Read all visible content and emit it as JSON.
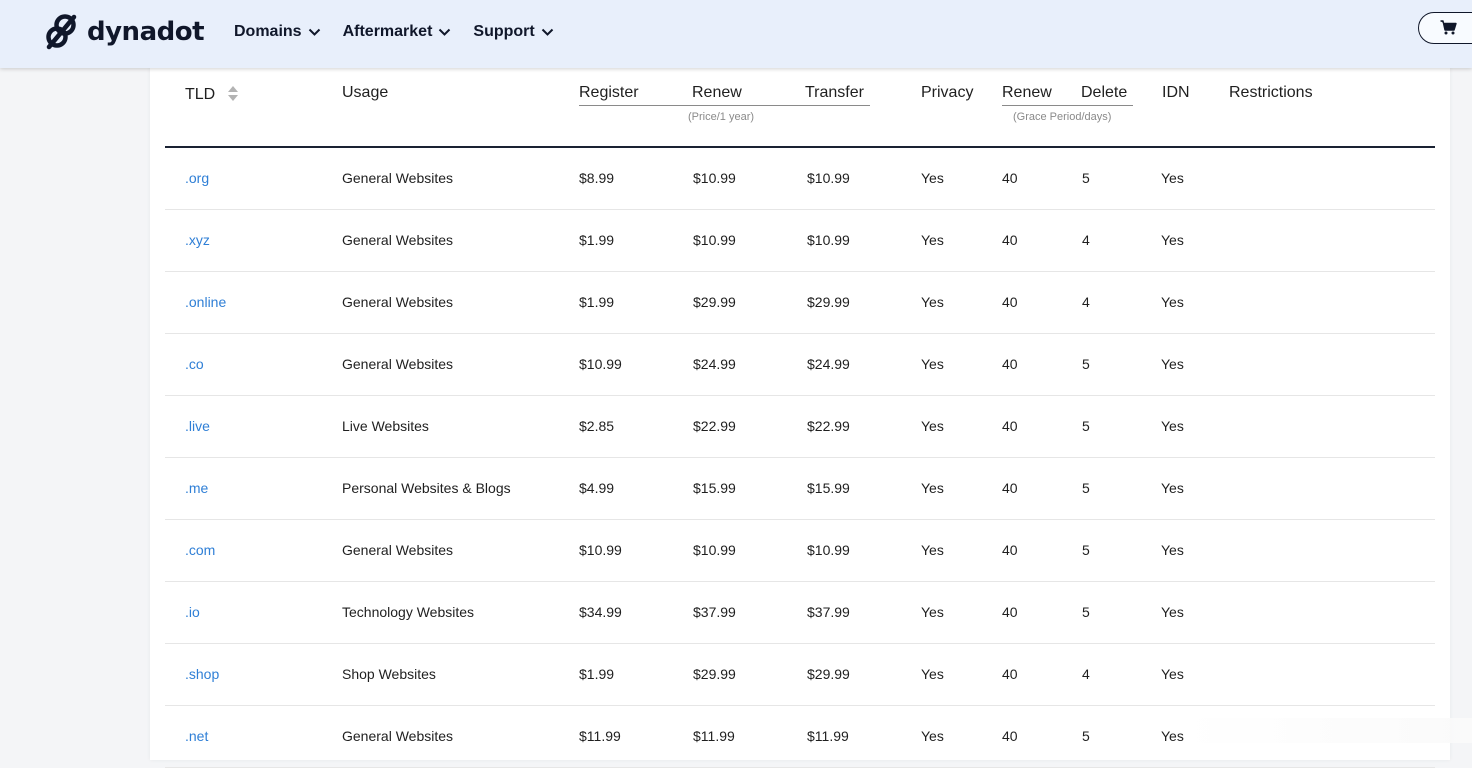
{
  "header": {
    "brand": "dynadot",
    "nav": [
      {
        "label": "Domains"
      },
      {
        "label": "Aftermarket"
      },
      {
        "label": "Support"
      }
    ]
  },
  "table": {
    "headers": {
      "tld": "TLD",
      "usage": "Usage",
      "register": "Register",
      "renew": "Renew",
      "transfer": "Transfer",
      "privacy": "Privacy",
      "grace_renew": "Renew",
      "grace_delete": "Delete",
      "idn": "IDN",
      "restrictions": "Restrictions"
    },
    "price_note": "(Price/1 year)",
    "grace_note": "(Grace Period/days)",
    "rows": [
      {
        "tld": ".org",
        "usage": "General Websites",
        "register": "$8.99",
        "renew": "$10.99",
        "transfer": "$10.99",
        "privacy": "Yes",
        "grace_renew": "40",
        "grace_delete": "5",
        "idn": "Yes"
      },
      {
        "tld": ".xyz",
        "usage": "General Websites",
        "register": "$1.99",
        "renew": "$10.99",
        "transfer": "$10.99",
        "privacy": "Yes",
        "grace_renew": "40",
        "grace_delete": "4",
        "idn": "Yes"
      },
      {
        "tld": ".online",
        "usage": "General Websites",
        "register": "$1.99",
        "renew": "$29.99",
        "transfer": "$29.99",
        "privacy": "Yes",
        "grace_renew": "40",
        "grace_delete": "4",
        "idn": "Yes"
      },
      {
        "tld": ".co",
        "usage": "General Websites",
        "register": "$10.99",
        "renew": "$24.99",
        "transfer": "$24.99",
        "privacy": "Yes",
        "grace_renew": "40",
        "grace_delete": "5",
        "idn": "Yes"
      },
      {
        "tld": ".live",
        "usage": "Live Websites",
        "register": "$2.85",
        "renew": "$22.99",
        "transfer": "$22.99",
        "privacy": "Yes",
        "grace_renew": "40",
        "grace_delete": "5",
        "idn": "Yes"
      },
      {
        "tld": ".me",
        "usage": "Personal Websites & Blogs",
        "register": "$4.99",
        "renew": "$15.99",
        "transfer": "$15.99",
        "privacy": "Yes",
        "grace_renew": "40",
        "grace_delete": "5",
        "idn": "Yes"
      },
      {
        "tld": ".com",
        "usage": "General Websites",
        "register": "$10.99",
        "renew": "$10.99",
        "transfer": "$10.99",
        "privacy": "Yes",
        "grace_renew": "40",
        "grace_delete": "5",
        "idn": "Yes"
      },
      {
        "tld": ".io",
        "usage": "Technology Websites",
        "register": "$34.99",
        "renew": "$37.99",
        "transfer": "$37.99",
        "privacy": "Yes",
        "grace_renew": "40",
        "grace_delete": "5",
        "idn": "Yes"
      },
      {
        "tld": ".shop",
        "usage": "Shop Websites",
        "register": "$1.99",
        "renew": "$29.99",
        "transfer": "$29.99",
        "privacy": "Yes",
        "grace_renew": "40",
        "grace_delete": "4",
        "idn": "Yes"
      },
      {
        "tld": ".net",
        "usage": "General Websites",
        "register": "$11.99",
        "renew": "$11.99",
        "transfer": "$11.99",
        "privacy": "Yes",
        "grace_renew": "40",
        "grace_delete": "5",
        "idn": "Yes"
      }
    ]
  },
  "colors": {
    "header_bg": "#e8effb",
    "link": "#2f7fd6",
    "brand": "#10172a"
  },
  "icons": [
    "dynadot-logo-icon",
    "chevron-down-icon",
    "sort-icon",
    "cart-icon"
  ]
}
